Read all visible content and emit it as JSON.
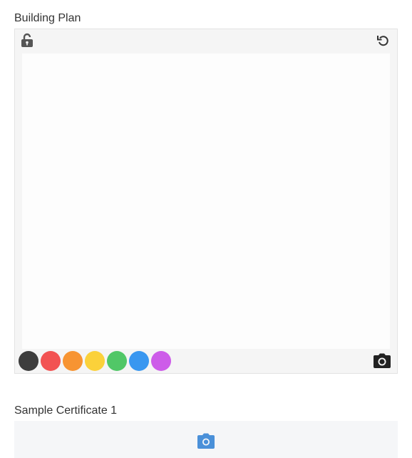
{
  "fields": {
    "building_plan_label": "Building Plan",
    "sample_certificate_label": "Sample Certificate 1"
  },
  "sketch": {
    "lock_icon": "unlocked-lock-icon",
    "undo_icon": "undo-icon",
    "camera_icon": "camera-icon",
    "palette": [
      {
        "name": "black",
        "color": "#3d3d3d"
      },
      {
        "name": "red",
        "color": "#f25252"
      },
      {
        "name": "orange",
        "color": "#f79432"
      },
      {
        "name": "yellow",
        "color": "#fbd13a"
      },
      {
        "name": "green",
        "color": "#51c767"
      },
      {
        "name": "blue",
        "color": "#3997f0"
      },
      {
        "name": "purple",
        "color": "#cd5ce9"
      }
    ]
  },
  "upload": {
    "camera_icon": "camera-icon",
    "accent_color": "#4a90d9"
  }
}
